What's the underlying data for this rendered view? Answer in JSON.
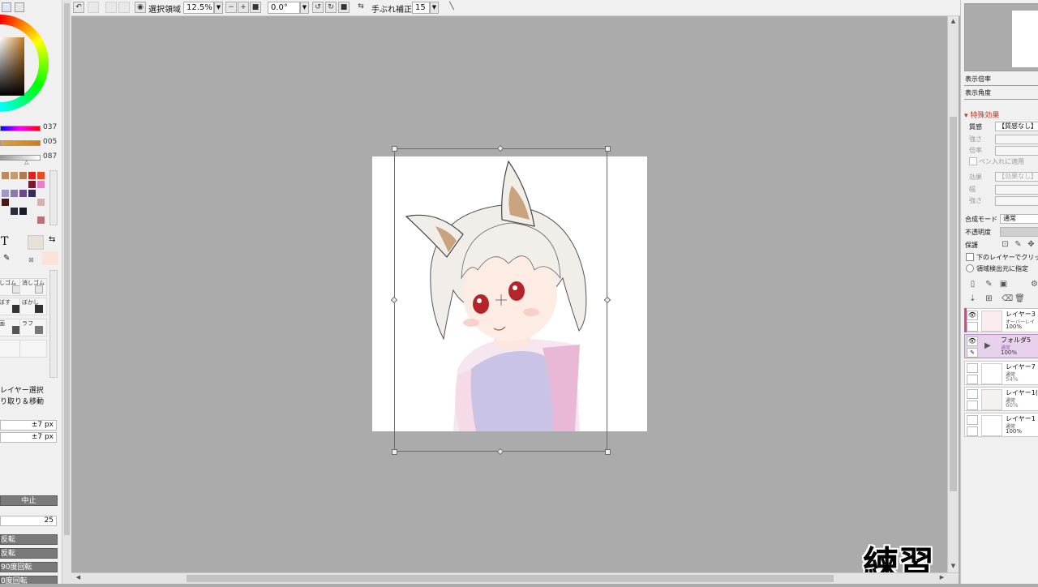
{
  "toolbar": {
    "selection_label": "選択領域",
    "zoom_value": "12.5%",
    "angle_value": "0.0°",
    "stabilizer_label": "手ぶれ補正",
    "stabilizer_value": "15"
  },
  "left_panel": {
    "slider_values": [
      "037",
      "005",
      "087"
    ],
    "text_tool_glyph": "T",
    "tools": [
      {
        "label": "しゴム"
      },
      {
        "label": "消しゴム"
      },
      {
        "label": "ぼす"
      },
      {
        "label": "ぼかし"
      },
      {
        "label": "画"
      },
      {
        "label": "ラフ"
      }
    ],
    "options": {
      "layer_select": "レイヤー選択",
      "cut_move": "り取り＆移動",
      "px1": "±7 px",
      "px2": "±7 px",
      "cancel_button": "中止",
      "value_25": "25",
      "rotate_buttons": [
        "反転",
        "反転",
        "90度回転",
        "0度回転"
      ]
    }
  },
  "right_panel": {
    "zoom_label": "表示倍率",
    "angle_label": "表示角度",
    "effects_header": "特殊効果",
    "texture_label": "質感",
    "texture_value": "【質感なし】",
    "strength_label": "強さ",
    "scale_label": "倍率",
    "pen_apply_label": "ペン入れに適用",
    "effect_label": "効果",
    "effect_value": "【効果なし】",
    "width_label": "幅",
    "strength2_label": "強さ",
    "blend_mode_label": "合成モード",
    "blend_mode_value": "通常",
    "opacity_label": "不透明度",
    "protect_label": "保護",
    "clip_label": "下のレイヤーでクリッピ",
    "selection_source_label": "領域検出元に指定",
    "layers": [
      {
        "name": "レイヤー3",
        "mode": "オーバーレイ",
        "opacity": "100%"
      },
      {
        "name": "フォルダ5",
        "mode": "通常",
        "opacity": "100%"
      },
      {
        "name": "レイヤー7",
        "mode": "通常",
        "opacity": "54%"
      },
      {
        "name": "レイヤー1(",
        "mode": "通常",
        "opacity": "60%"
      },
      {
        "name": "レイヤー1",
        "mode": "通常",
        "opacity": "100%"
      }
    ]
  },
  "watermark": "練習",
  "colors": {
    "panel_bg": "#f0f0f0",
    "canvas_bg": "#ababab",
    "selected_layer": "#e7d1ec",
    "accent_pink": "#d9488a"
  }
}
